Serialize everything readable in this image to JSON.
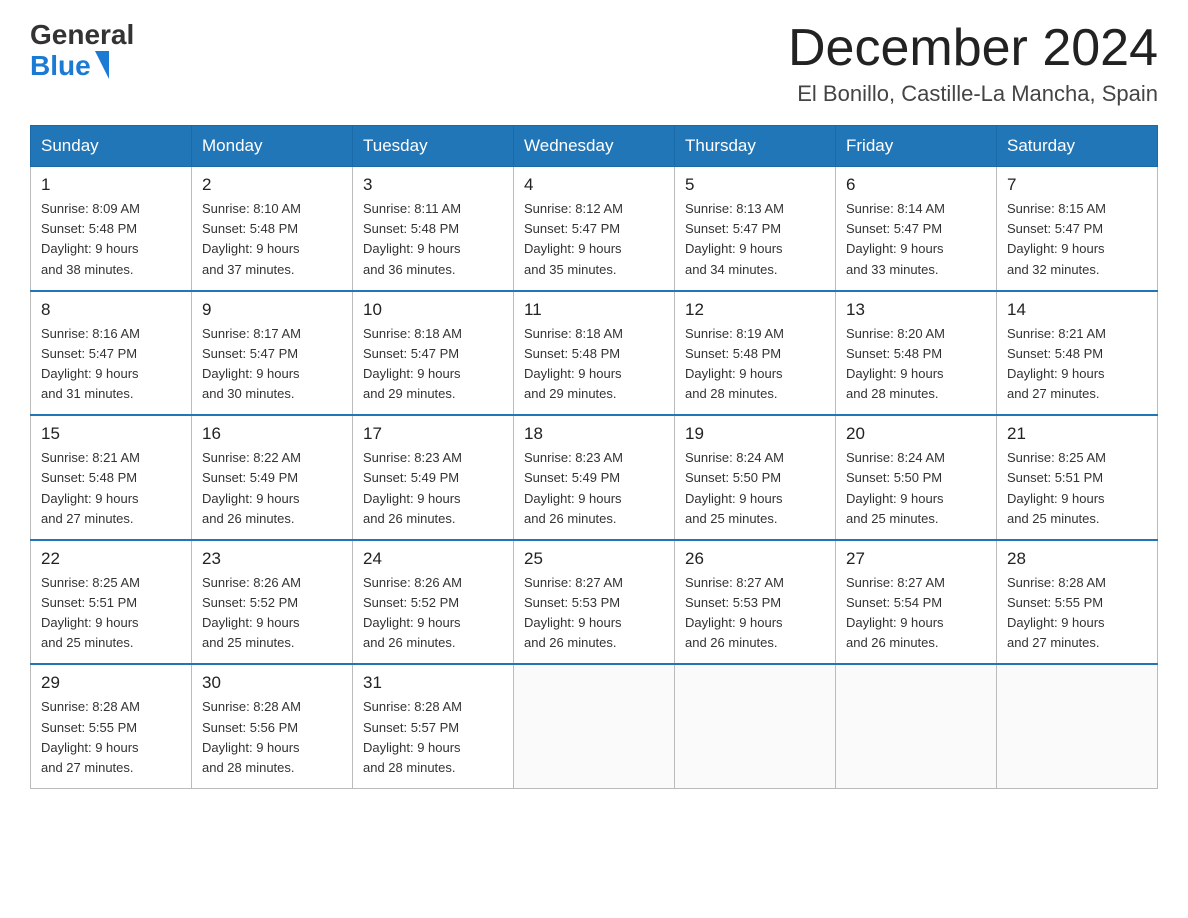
{
  "header": {
    "logo": {
      "general": "General",
      "blue": "Blue"
    },
    "title": "December 2024",
    "location": "El Bonillo, Castille-La Mancha, Spain"
  },
  "weekdays": [
    "Sunday",
    "Monday",
    "Tuesday",
    "Wednesday",
    "Thursday",
    "Friday",
    "Saturday"
  ],
  "weeks": [
    [
      {
        "day": "1",
        "sunrise": "8:09 AM",
        "sunset": "5:48 PM",
        "daylight": "9 hours and 38 minutes."
      },
      {
        "day": "2",
        "sunrise": "8:10 AM",
        "sunset": "5:48 PM",
        "daylight": "9 hours and 37 minutes."
      },
      {
        "day": "3",
        "sunrise": "8:11 AM",
        "sunset": "5:48 PM",
        "daylight": "9 hours and 36 minutes."
      },
      {
        "day": "4",
        "sunrise": "8:12 AM",
        "sunset": "5:47 PM",
        "daylight": "9 hours and 35 minutes."
      },
      {
        "day": "5",
        "sunrise": "8:13 AM",
        "sunset": "5:47 PM",
        "daylight": "9 hours and 34 minutes."
      },
      {
        "day": "6",
        "sunrise": "8:14 AM",
        "sunset": "5:47 PM",
        "daylight": "9 hours and 33 minutes."
      },
      {
        "day": "7",
        "sunrise": "8:15 AM",
        "sunset": "5:47 PM",
        "daylight": "9 hours and 32 minutes."
      }
    ],
    [
      {
        "day": "8",
        "sunrise": "8:16 AM",
        "sunset": "5:47 PM",
        "daylight": "9 hours and 31 minutes."
      },
      {
        "day": "9",
        "sunrise": "8:17 AM",
        "sunset": "5:47 PM",
        "daylight": "9 hours and 30 minutes."
      },
      {
        "day": "10",
        "sunrise": "8:18 AM",
        "sunset": "5:47 PM",
        "daylight": "9 hours and 29 minutes."
      },
      {
        "day": "11",
        "sunrise": "8:18 AM",
        "sunset": "5:48 PM",
        "daylight": "9 hours and 29 minutes."
      },
      {
        "day": "12",
        "sunrise": "8:19 AM",
        "sunset": "5:48 PM",
        "daylight": "9 hours and 28 minutes."
      },
      {
        "day": "13",
        "sunrise": "8:20 AM",
        "sunset": "5:48 PM",
        "daylight": "9 hours and 28 minutes."
      },
      {
        "day": "14",
        "sunrise": "8:21 AM",
        "sunset": "5:48 PM",
        "daylight": "9 hours and 27 minutes."
      }
    ],
    [
      {
        "day": "15",
        "sunrise": "8:21 AM",
        "sunset": "5:48 PM",
        "daylight": "9 hours and 27 minutes."
      },
      {
        "day": "16",
        "sunrise": "8:22 AM",
        "sunset": "5:49 PM",
        "daylight": "9 hours and 26 minutes."
      },
      {
        "day": "17",
        "sunrise": "8:23 AM",
        "sunset": "5:49 PM",
        "daylight": "9 hours and 26 minutes."
      },
      {
        "day": "18",
        "sunrise": "8:23 AM",
        "sunset": "5:49 PM",
        "daylight": "9 hours and 26 minutes."
      },
      {
        "day": "19",
        "sunrise": "8:24 AM",
        "sunset": "5:50 PM",
        "daylight": "9 hours and 25 minutes."
      },
      {
        "day": "20",
        "sunrise": "8:24 AM",
        "sunset": "5:50 PM",
        "daylight": "9 hours and 25 minutes."
      },
      {
        "day": "21",
        "sunrise": "8:25 AM",
        "sunset": "5:51 PM",
        "daylight": "9 hours and 25 minutes."
      }
    ],
    [
      {
        "day": "22",
        "sunrise": "8:25 AM",
        "sunset": "5:51 PM",
        "daylight": "9 hours and 25 minutes."
      },
      {
        "day": "23",
        "sunrise": "8:26 AM",
        "sunset": "5:52 PM",
        "daylight": "9 hours and 25 minutes."
      },
      {
        "day": "24",
        "sunrise": "8:26 AM",
        "sunset": "5:52 PM",
        "daylight": "9 hours and 26 minutes."
      },
      {
        "day": "25",
        "sunrise": "8:27 AM",
        "sunset": "5:53 PM",
        "daylight": "9 hours and 26 minutes."
      },
      {
        "day": "26",
        "sunrise": "8:27 AM",
        "sunset": "5:53 PM",
        "daylight": "9 hours and 26 minutes."
      },
      {
        "day": "27",
        "sunrise": "8:27 AM",
        "sunset": "5:54 PM",
        "daylight": "9 hours and 26 minutes."
      },
      {
        "day": "28",
        "sunrise": "8:28 AM",
        "sunset": "5:55 PM",
        "daylight": "9 hours and 27 minutes."
      }
    ],
    [
      {
        "day": "29",
        "sunrise": "8:28 AM",
        "sunset": "5:55 PM",
        "daylight": "9 hours and 27 minutes."
      },
      {
        "day": "30",
        "sunrise": "8:28 AM",
        "sunset": "5:56 PM",
        "daylight": "9 hours and 28 minutes."
      },
      {
        "day": "31",
        "sunrise": "8:28 AM",
        "sunset": "5:57 PM",
        "daylight": "9 hours and 28 minutes."
      },
      null,
      null,
      null,
      null
    ]
  ]
}
